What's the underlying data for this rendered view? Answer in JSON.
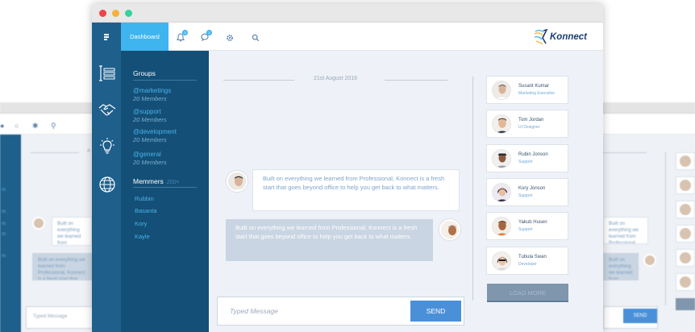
{
  "background_window": {
    "date_prefix": "A",
    "incoming_message": "Built on everything we learned from Professional, Konnect is a fresh start that goes beyond office to help you get back to what matters.",
    "outgoing_message": "Built on everything we learned from Professional, Konnect is a fresh start that goes beyond office to help you get back to what matters.",
    "input_placeholder": "Typed Message",
    "send_label": "SEND",
    "left_snippets": [
      "m",
      "rs",
      "rs",
      "rs",
      "rs"
    ]
  },
  "header": {
    "dashboard_label": "Dashboard",
    "notification_badge": "3",
    "message_badge": "2",
    "logo_text": "Konnect"
  },
  "sidebar": {
    "groups_title": "Groups",
    "groups": [
      {
        "name": "@marketings",
        "members": "20 Members"
      },
      {
        "name": "@support",
        "members": "20 Members"
      },
      {
        "name": "@development",
        "members": "20 Members"
      },
      {
        "name": "@general",
        "members": "20 Members"
      }
    ],
    "members_title": "Memmers",
    "members_count": "200+",
    "members": [
      "Rubbin",
      "Basanta",
      "Kory",
      "Kayle"
    ]
  },
  "chat": {
    "date": "21st August 2016",
    "incoming_message": "Built on everything we learned from Professional, Konnect is a fresh start that goes beyond office to help you get back to what matters.",
    "outgoing_message": "Built on everything we learned from Professional, Konnect is a fresh start that goes beyond office to help you get back to what matters.",
    "input_placeholder": "Typed Message",
    "send_label": "SEND"
  },
  "contacts": [
    {
      "name": "Susant Kumar",
      "role": "Marketing Executive"
    },
    {
      "name": "Tom Jordan",
      "role": "UI Designer"
    },
    {
      "name": "Rubin Jonson",
      "role": "Support"
    },
    {
      "name": "Kory Jonson",
      "role": "Support"
    },
    {
      "name": "Yakub Husen",
      "role": "Support"
    },
    {
      "name": "Tubula Swan",
      "role": "Developer"
    }
  ],
  "load_more_label": "LOAD MORE",
  "colors": {
    "accent": "#3eb5ee",
    "rail": "#1e5f8c",
    "sidebar": "#134f76",
    "send": "#4a90d9",
    "load_more": "#7f96ad"
  },
  "icons": {
    "header": [
      "menu-icon",
      "bell-icon",
      "chat-bubble-icon",
      "gear-icon",
      "search-icon"
    ],
    "rail": [
      "list-icon",
      "handshake-icon",
      "lightbulb-icon",
      "globe-icon"
    ]
  }
}
